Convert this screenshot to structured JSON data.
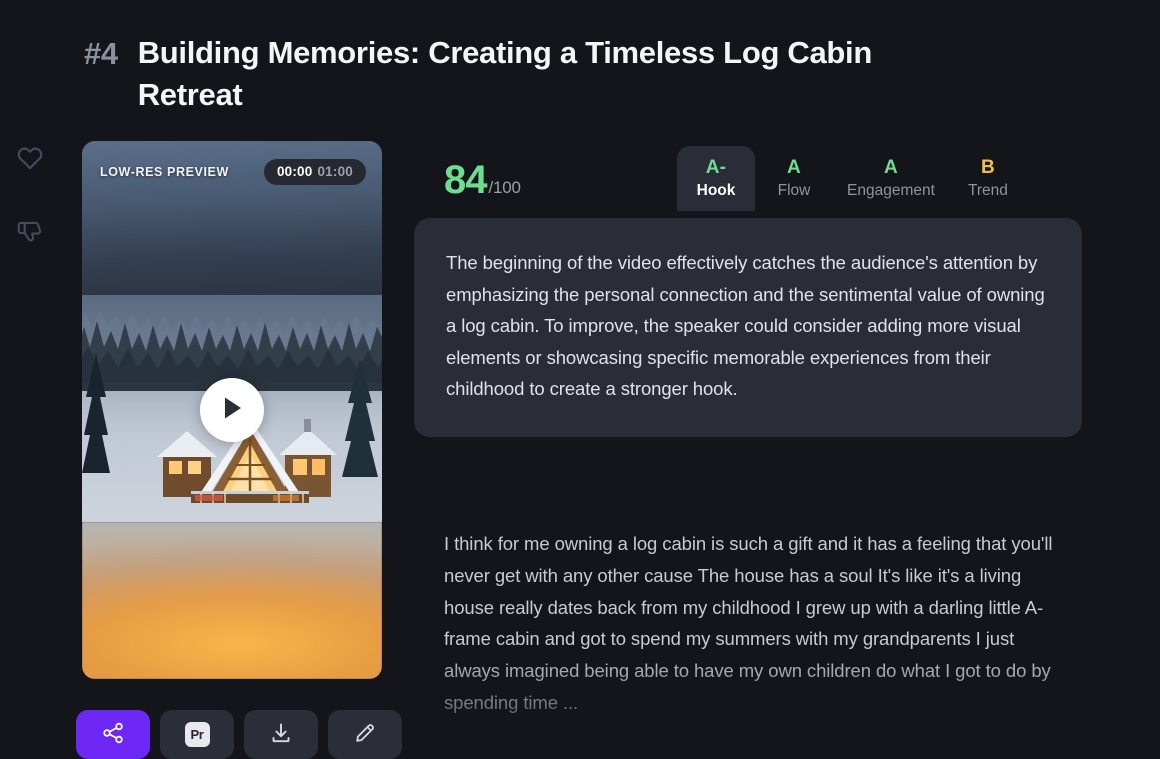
{
  "rail": {
    "like": {
      "icon": "heart-icon",
      "label": "Like"
    },
    "dislike": {
      "icon": "thumbs-down-icon",
      "label": "Dislike"
    }
  },
  "header": {
    "rank": "#4",
    "title": "Building Memories: Creating a Timeless Log Cabin Retreat"
  },
  "preview": {
    "watermark": "LOW-RES PREVIEW",
    "current_time": "00:00",
    "total_time": "01:00",
    "play_icon": "play-icon"
  },
  "actions": [
    {
      "name": "share-button",
      "icon": "share-icon",
      "label": "Share",
      "accent": "#6d28f5",
      "active": true
    },
    {
      "name": "premiere-pro-button",
      "icon": "premiere-pro-icon",
      "label": "Pr",
      "active": false
    },
    {
      "name": "download-button",
      "icon": "download-icon",
      "label": "Download",
      "active": false
    },
    {
      "name": "edit-button",
      "icon": "pencil-icon",
      "label": "Edit",
      "active": false
    }
  ],
  "score": {
    "value": "84",
    "max": "/100",
    "color": "#6edd8f"
  },
  "tabs": [
    {
      "label": "Hook",
      "grade": "A-",
      "grade_color": "#6edd8f",
      "active": true
    },
    {
      "label": "Flow",
      "grade": "A",
      "grade_color": "#6edd8f",
      "active": false
    },
    {
      "label": "Engagement",
      "grade": "A",
      "grade_color": "#6edd8f",
      "active": false
    },
    {
      "label": "Trend",
      "grade": "B",
      "grade_color": "#f2c23e",
      "active": false
    }
  ],
  "feedback": {
    "text": "The beginning of the video effectively catches the audience's attention by emphasizing the personal connection and the sentimental value of owning a log cabin. To improve, the speaker could consider adding more visual elements or showcasing specific memorable experiences from their childhood to create a stronger hook."
  },
  "transcript": {
    "text": "I think for me owning a log cabin is such a gift and it has a feeling that you'll never get with any other cause The house has a soul It's like it's a living house really dates back from my childhood I grew up with a darling little A-frame cabin and got to spend my summers with my grandparents I just always imagined being able to have my own children do what I got to do by spending time ..."
  },
  "theme": {
    "background": "#14151b",
    "panel": "#2a2c38",
    "accent_purple": "#6d28f5",
    "grade_green": "#6edd8f",
    "grade_yellow": "#f2c23e"
  }
}
